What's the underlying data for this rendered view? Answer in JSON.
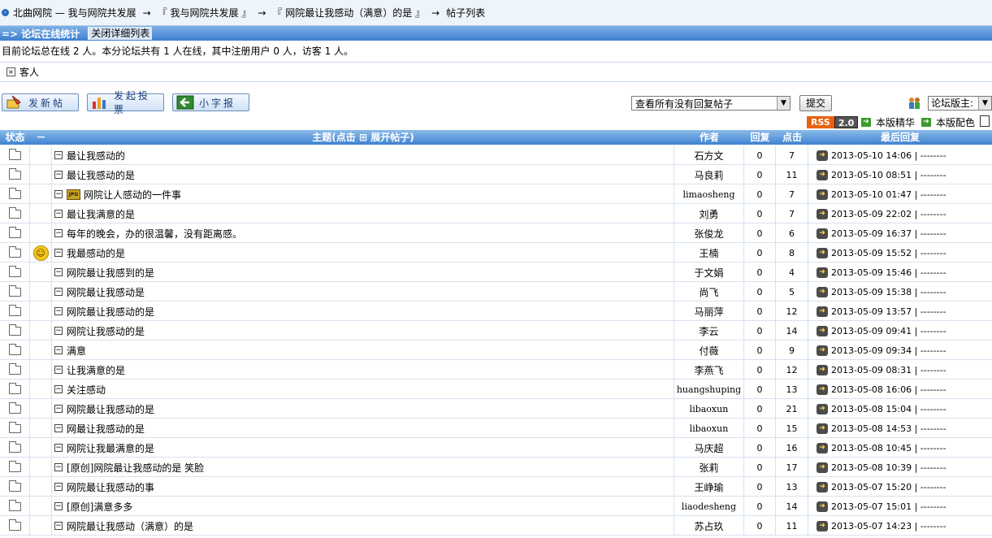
{
  "breadcrumb": {
    "items": [
      "北曲网院 — 我与网院共发展",
      "『 我与网院共发展 』",
      "『 网院最让我感动（满意）的是 』",
      "帖子列表"
    ],
    "separator": "→"
  },
  "online": {
    "title": "=> 论坛在线统计",
    "toggle_label": "关闭详细列表",
    "stats_text": "目前论坛总在线 2 人。本分论坛共有 1 人在线，其中注册用户 0 人，访客 1 人。",
    "guest_label": "客人"
  },
  "actions": {
    "new_post": "发新帖",
    "new_poll": "发起投票",
    "small_post": "小字报"
  },
  "filter": {
    "selected": "查看所有没有回复帖子",
    "submit_label": "提交",
    "moderators_label": "论坛版主:"
  },
  "board_links": {
    "rss_a": "RSS",
    "rss_b": "2.0",
    "elite": "本版精华",
    "colors": "本版配色"
  },
  "table": {
    "headers": {
      "status": "状态",
      "mark": "－",
      "title": "主题(点击 ⊞ 展开帖子)",
      "author": "作者",
      "reply": "回复",
      "click": "点击",
      "last": "最后回复"
    },
    "rows": [
      {
        "title": "最让我感动的",
        "author": "石方文",
        "reply": "0",
        "click": "7",
        "last": "2013-05-10 14:06 | --------"
      },
      {
        "title": "最让我感动的是",
        "author": "马良莉",
        "reply": "0",
        "click": "11",
        "last": "2013-05-10 08:51 | --------"
      },
      {
        "title": "网院让人感动的一件事",
        "author": "limaosheng",
        "reply": "0",
        "click": "7",
        "last": "2013-05-10 01:47 | --------",
        "badge": "JPG"
      },
      {
        "title": "最让我满意的是",
        "author": "刘勇",
        "reply": "0",
        "click": "7",
        "last": "2013-05-09 22:02 | --------"
      },
      {
        "title": "每年的晚会，办的很温馨，没有距离感。",
        "author": "张俊龙",
        "reply": "0",
        "click": "6",
        "last": "2013-05-09 16:37 | --------"
      },
      {
        "title": "我最感动的是",
        "author": "王楠",
        "reply": "0",
        "click": "8",
        "last": "2013-05-09 15:52 | --------",
        "mark": "smiley"
      },
      {
        "title": "网院最让我感到的是",
        "author": "于文娟",
        "reply": "0",
        "click": "4",
        "last": "2013-05-09 15:46 | --------"
      },
      {
        "title": "网院最让我感动是",
        "author": "尚飞",
        "reply": "0",
        "click": "5",
        "last": "2013-05-09 15:38 | --------"
      },
      {
        "title": "网院最让我感动的是",
        "author": "马丽萍",
        "reply": "0",
        "click": "12",
        "last": "2013-05-09 13:57 | --------"
      },
      {
        "title": "网院让我感动的是",
        "author": "李云",
        "reply": "0",
        "click": "14",
        "last": "2013-05-09 09:41 | --------"
      },
      {
        "title": "满意",
        "author": "付薇",
        "reply": "0",
        "click": "9",
        "last": "2013-05-09 09:34 | --------"
      },
      {
        "title": "让我满意的是",
        "author": "李燕飞",
        "reply": "0",
        "click": "12",
        "last": "2013-05-09 08:31 | --------"
      },
      {
        "title": "关注感动",
        "author": "huangshuping",
        "reply": "0",
        "click": "13",
        "last": "2013-05-08 16:06 | --------"
      },
      {
        "title": "网院最让我感动的是",
        "author": "libaoxun",
        "reply": "0",
        "click": "21",
        "last": "2013-05-08 15:04 | --------"
      },
      {
        "title": "网最让我感动的是",
        "author": "libaoxun",
        "reply": "0",
        "click": "15",
        "last": "2013-05-08 14:53 | --------"
      },
      {
        "title": "网院让我最满意的是",
        "author": "马庆超",
        "reply": "0",
        "click": "16",
        "last": "2013-05-08 10:45 | --------"
      },
      {
        "title": "[原创]网院最让我感动的是 笑脸",
        "author": "张莉",
        "reply": "0",
        "click": "17",
        "last": "2013-05-08 10:39 | --------"
      },
      {
        "title": "网院最让我感动的事",
        "author": "王峥瑜",
        "reply": "0",
        "click": "13",
        "last": "2013-05-07 15:20 | --------"
      },
      {
        "title": "[原创]满意多多",
        "author": "liaodesheng",
        "reply": "0",
        "click": "14",
        "last": "2013-05-07 15:01 | --------"
      },
      {
        "title": "网院最让我感动（满意）的是",
        "author": "苏占玖",
        "reply": "0",
        "click": "11",
        "last": "2013-05-07 14:23 | --------"
      }
    ]
  }
}
